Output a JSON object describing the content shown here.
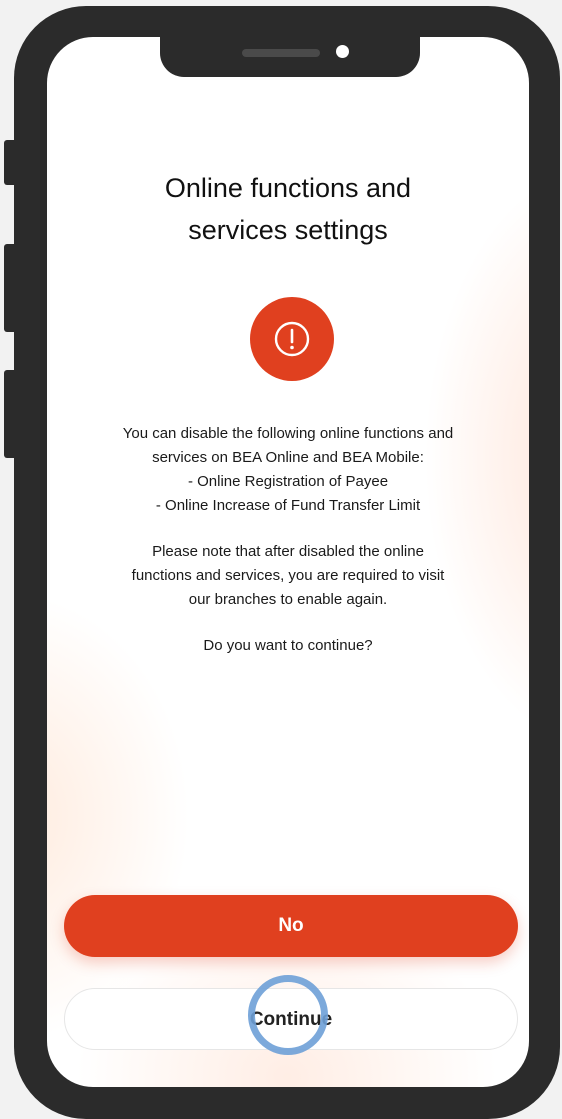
{
  "page": {
    "title_line1": "Online functions and",
    "title_line2": "services settings",
    "alert_icon": "exclamation-circle-icon",
    "body": {
      "intro_line1": "You can disable the following online functions and",
      "intro_line2": "services on BEA Online and BEA Mobile:",
      "item1": "- Online Registration of Payee",
      "item2": "- Online Increase of Fund Transfer Limit",
      "note_line1": "Please note that after disabled the online",
      "note_line2": "functions and services, you are required to visit",
      "note_line3": "our branches to enable again.",
      "question": "Do you want to continue?"
    },
    "buttons": {
      "no_label": "No",
      "continue_label": "Continue"
    }
  },
  "colors": {
    "accent": "#e0401f",
    "frame": "#2b2b2b",
    "tap_indicator": "#6ea0d7"
  }
}
